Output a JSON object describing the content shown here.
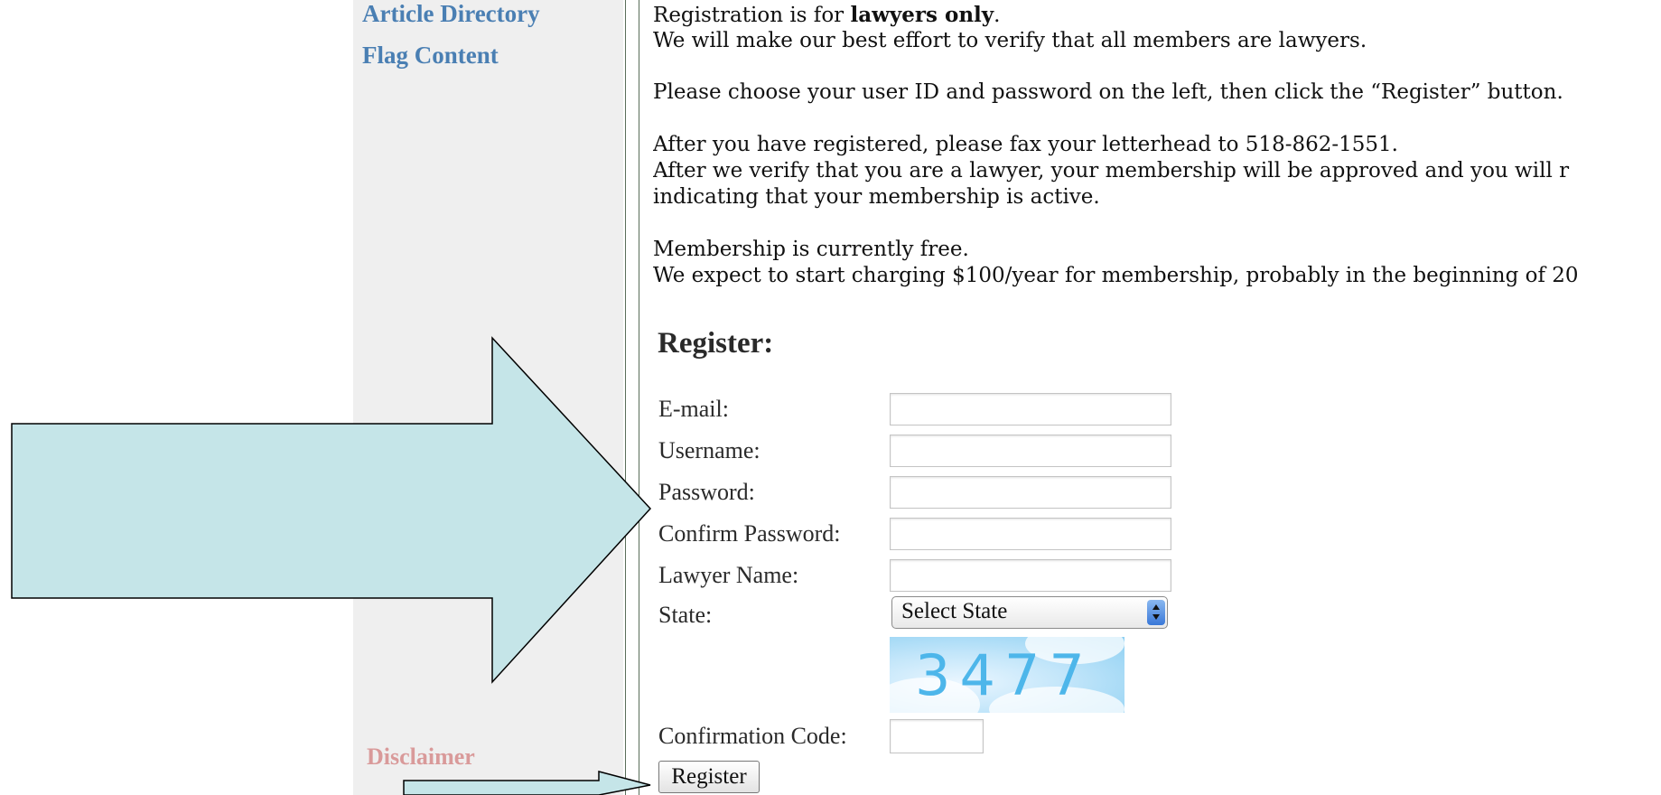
{
  "sidebar": {
    "links": [
      "Article Directory",
      "Flag Content"
    ],
    "disclaimer": "Disclaimer"
  },
  "intro": {
    "line1_prefix": "Registration is for ",
    "line1_bold": "lawyers only",
    "line1_suffix": ".",
    "line2": "We will make our best effort to verify that all members are lawyers.",
    "line3": "Please choose your user ID and password on the left, then click the “Register” button.",
    "line4": "After you have registered, please fax your letterhead to 518-862-1551.",
    "line5": "After we verify that you are a lawyer, your membership will be approved and you will r",
    "line6": "indicating that your membership is active.",
    "line7": "Membership is currently free.",
    "line8": "We expect to start charging $100/year for membership, probably in the beginning of 20"
  },
  "form": {
    "heading": "Register:",
    "fields": {
      "email": "E-mail:",
      "username": "Username:",
      "password": "Password:",
      "confirm_password": "Confirm Password:",
      "lawyer_name": "Lawyer Name:",
      "state": "State:",
      "confirmation_code": "Confirmation Code:"
    },
    "state_selected": "Select State",
    "captcha_code": "3477",
    "submit_label": "Register"
  },
  "colors": {
    "sidebar_bg": "#efefef",
    "link": "#4a7fb3",
    "disclaimer": "#d99a9a",
    "arrow_fill": "#c5e5e8",
    "arrow_stroke": "#000000"
  }
}
